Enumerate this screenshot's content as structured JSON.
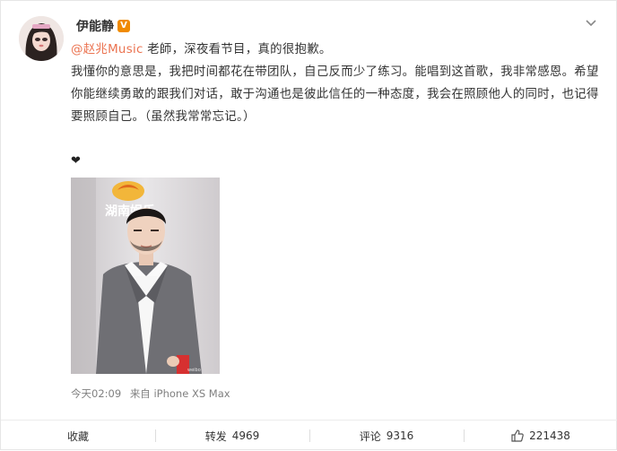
{
  "post": {
    "username": "伊能静",
    "badge": "V",
    "mention": "@赵兆Music",
    "first_line": " 老師，深夜看节目，真的很抱歉。",
    "body": "我懂你的意思是，我把时间都花在带团队，自己反而少了练习。能唱到这首歌，我非常感恩。希望你能继续勇敢的跟我们对话，敢于沟通也是彼此信任的一种态度，我会在照顾他人的同时，也记得要照顾自己。（虽然我常常忘记。）",
    "heart": "❤",
    "image_watermark": "湖南娱乐",
    "time": "今天02:09",
    "source": "来自 iPhone XS Max"
  },
  "actions": {
    "favorite": "收藏",
    "repost_label": "转发",
    "repost_count": "4969",
    "comment_label": "评论",
    "comment_count": "9316",
    "like_count": "221438"
  },
  "colors": {
    "mention": "#eb7350",
    "badge": "#f08a00"
  }
}
